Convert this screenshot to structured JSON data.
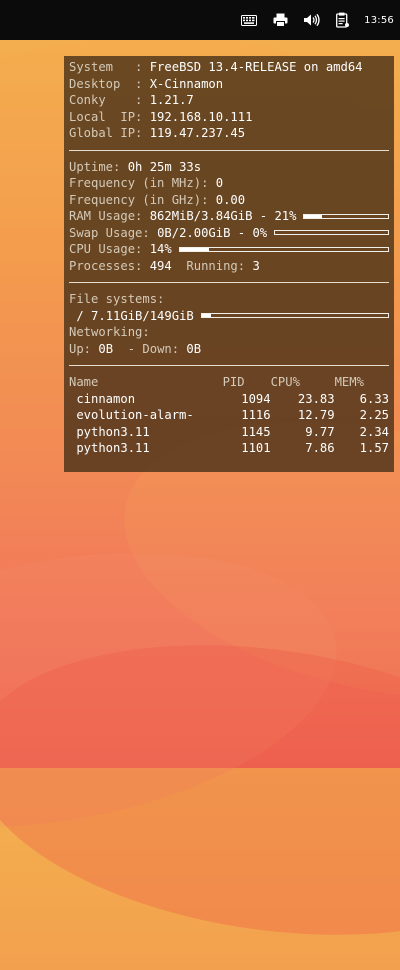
{
  "panel": {
    "clock": "13:56",
    "icons": [
      "keyboard-icon",
      "printer-icon",
      "volume-icon",
      "clipboard-icon"
    ]
  },
  "conky": {
    "system": {
      "label": "System   : ",
      "value": "FreeBSD 13.4-RELEASE on amd64"
    },
    "desktop": {
      "label": "Desktop  : ",
      "value": "X-Cinnamon"
    },
    "conky": {
      "label": "Conky    : ",
      "value": "1.21.7"
    },
    "local_ip": {
      "label": "Local  IP: ",
      "value": "192.168.10.111"
    },
    "global_ip": {
      "label": "Global IP: ",
      "value": "119.47.237.45"
    },
    "uptime": {
      "label": "Uptime: ",
      "value": "0h 25m 33s"
    },
    "freq_mhz": {
      "label": "Frequency (in MHz): ",
      "value": "0"
    },
    "freq_ghz": {
      "label": "Frequency (in GHz): ",
      "value": "0.00"
    },
    "ram": {
      "label": "RAM Usage: ",
      "value": "862MiB/3.84GiB - 21%",
      "percent": 21
    },
    "swap": {
      "label": "Swap Usage: ",
      "value": "0B/2.00GiB - 0%",
      "percent": 0
    },
    "cpu": {
      "label": "CPU Usage: ",
      "value": "14%",
      "percent": 14
    },
    "processes": {
      "label": "Processes: ",
      "value": "494",
      "running_label": "  Running: ",
      "running_value": "3"
    },
    "filesystems": {
      "label": "File systems:",
      "mount": " / ",
      "value": "7.11GiB/149GiB",
      "percent": 5
    },
    "networking": {
      "label": "Networking:",
      "up_label": "Up: ",
      "up_value": "0B",
      "down_label": "  - Down: ",
      "down_value": "0B"
    },
    "process_table": {
      "headers": [
        "Name",
        "PID",
        "CPU%",
        "MEM%"
      ],
      "rows": [
        {
          "name": " cinnamon",
          "pid": "1094",
          "cpu": "23.83",
          "mem": "6.33"
        },
        {
          "name": " evolution-alarm-",
          "pid": "1116",
          "cpu": "12.79",
          "mem": "2.25"
        },
        {
          "name": " python3.11",
          "pid": "1145",
          "cpu": "9.77",
          "mem": "2.34"
        },
        {
          "name": " python3.11",
          "pid": "1101",
          "cpu": "7.86",
          "mem": "1.57"
        }
      ]
    }
  }
}
